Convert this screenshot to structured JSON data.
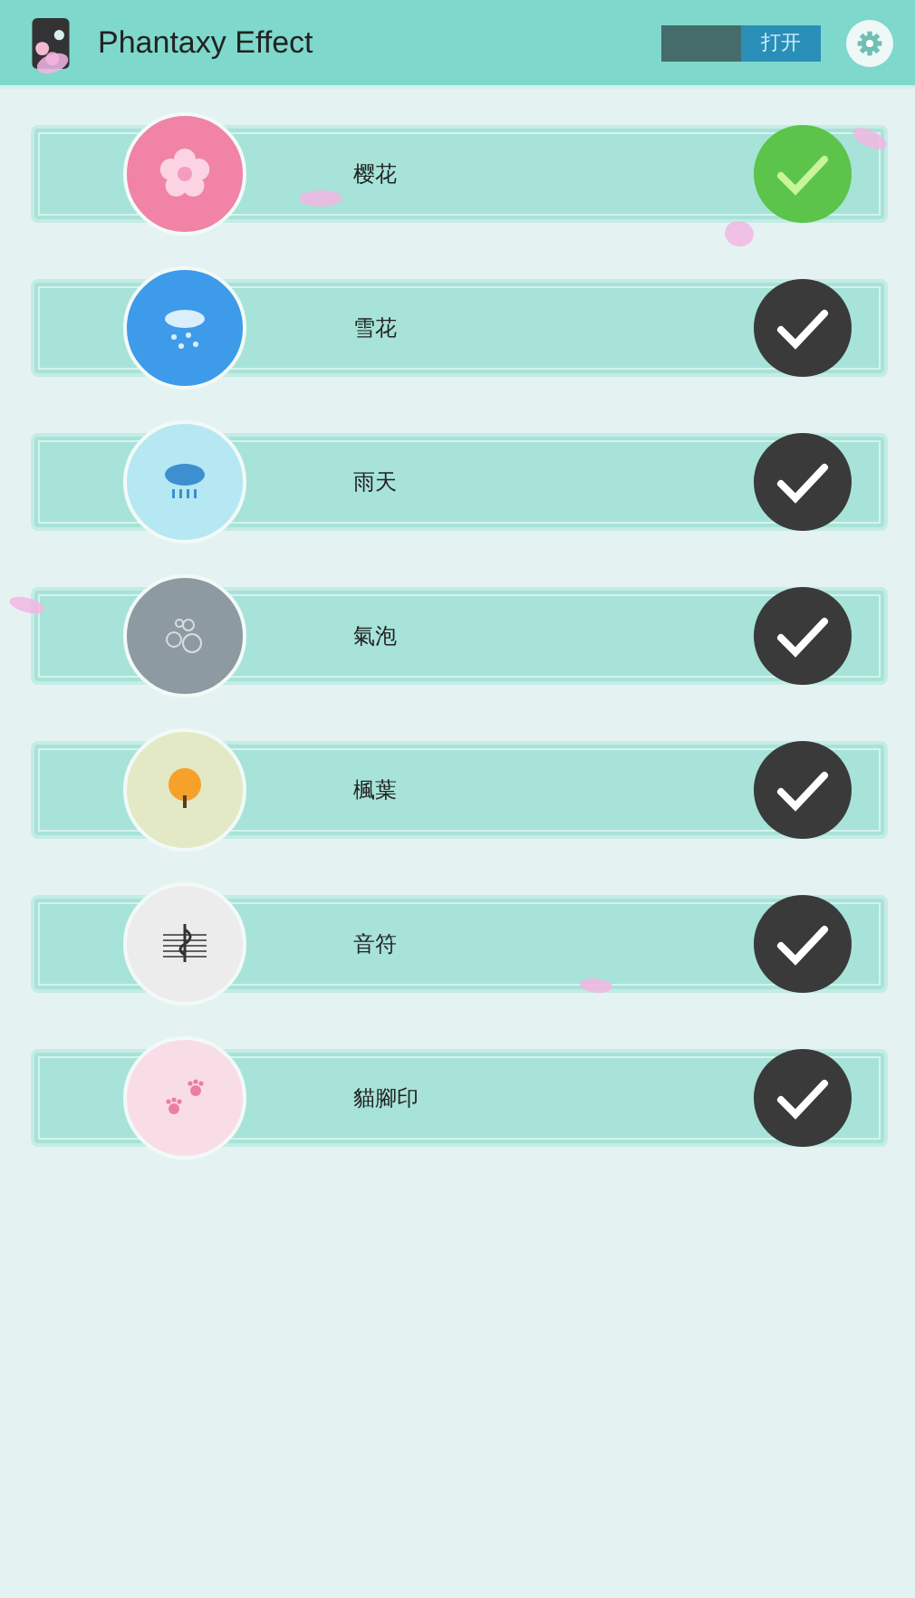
{
  "header": {
    "title": "Phantaxy Effect",
    "toggle": {
      "label": "打开",
      "on": true
    }
  },
  "effects": [
    {
      "label": "樱花",
      "kind": "sakura",
      "color": "#f083a6",
      "selected": true
    },
    {
      "label": "雪花",
      "kind": "snow",
      "color": "#3e9be9",
      "selected": false
    },
    {
      "label": "雨天",
      "kind": "rain",
      "color": "#b5e8f2",
      "selected": false
    },
    {
      "label": "氣泡",
      "kind": "bubble",
      "color": "#8e9aa2",
      "selected": false
    },
    {
      "label": "楓葉",
      "kind": "maple",
      "color": "#e2e9c4",
      "selected": false
    },
    {
      "label": "音符",
      "kind": "music",
      "color": "#ececec",
      "selected": false
    },
    {
      "label": "貓腳印",
      "kind": "paw",
      "color": "#f9dde6",
      "selected": false
    }
  ]
}
